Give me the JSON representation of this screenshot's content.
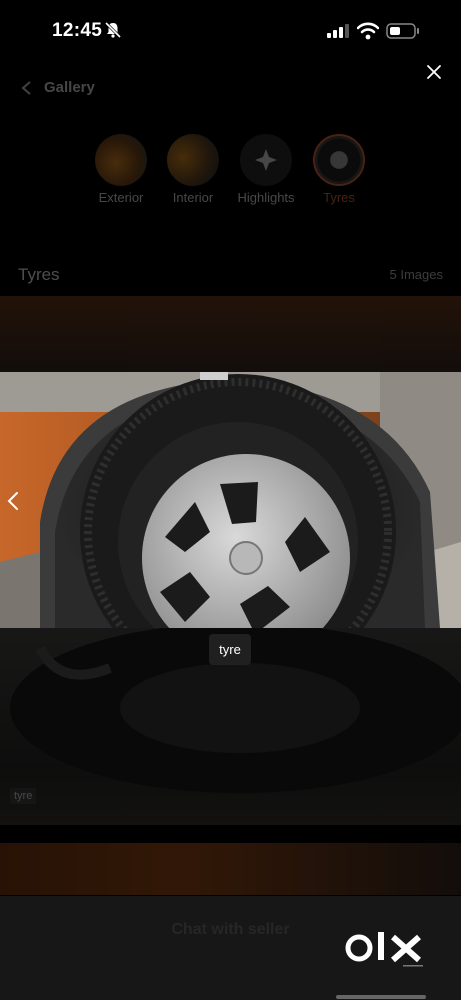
{
  "status": {
    "time": "12:45"
  },
  "gallery": {
    "title": "Gallery",
    "categories": [
      {
        "label": "Exterior"
      },
      {
        "label": "Interior"
      },
      {
        "label": "Highlights"
      },
      {
        "label": "Tyres"
      }
    ],
    "section_title": "Tyres",
    "image_count": "5 Images",
    "under_tag": "tyre",
    "chat_label": "Chat with seller"
  },
  "viewer": {
    "tag": "tyre"
  },
  "brand": "olx",
  "colors": {
    "accent": "#e06b3a",
    "background": "#000000"
  }
}
